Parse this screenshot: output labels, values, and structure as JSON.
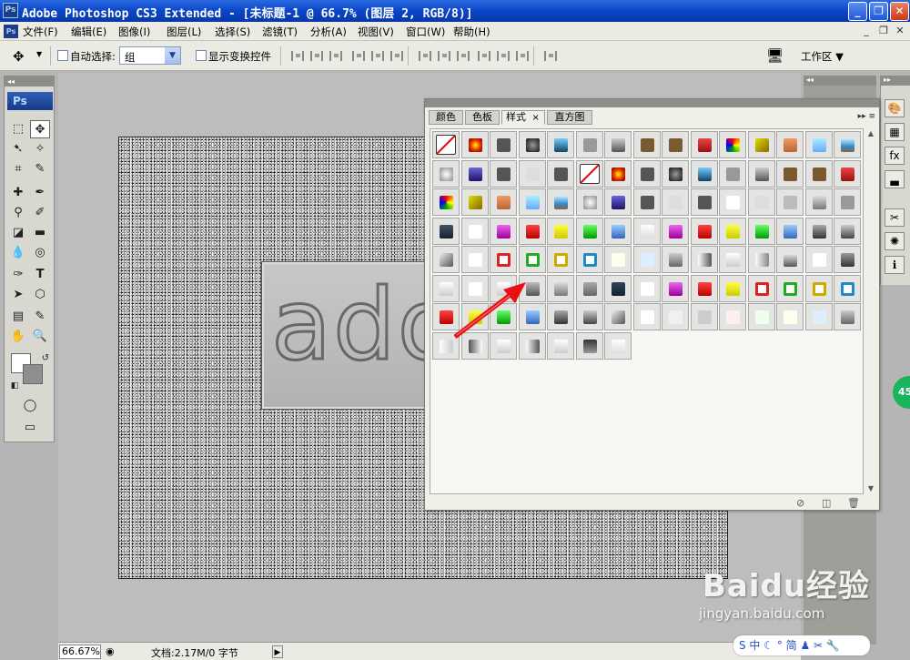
{
  "window": {
    "title": "Adobe Photoshop CS3 Extended - [未标题-1 @ 66.7% (图层 2, RGB/8)]",
    "app_icon": "Ps",
    "controls": [
      "minimize-icon",
      "restore-icon",
      "close-icon"
    ]
  },
  "menubar": {
    "items": [
      "文件(F)",
      "编辑(E)",
      "图像(I)",
      "图层(L)",
      "选择(S)",
      "滤镜(T)",
      "分析(A)",
      "视图(V)",
      "窗口(W)",
      "帮助(H)"
    ]
  },
  "options_bar": {
    "auto_select_label": "自动选择:",
    "auto_select_value": "组",
    "auto_select_checked": false,
    "show_transform_label": "显示变换控件",
    "show_transform_checked": false,
    "workspace_label": "工作区 ▼"
  },
  "toolbox": {
    "logo": "Ps",
    "foreground_color": "#ffffff",
    "background_color": "#8e8e8e"
  },
  "document": {
    "layer_text": "adob"
  },
  "styles_panel": {
    "tabs": [
      "颜色",
      "色板",
      "样式",
      "直方图"
    ],
    "active_tab": "样式",
    "tab_close": "×",
    "bottom_icons": [
      "clear-style-icon",
      "new-style-icon",
      "trash-icon"
    ]
  },
  "statusbar": {
    "zoom": "66.67%",
    "doc_info": "文档:2.17M/0 字节"
  },
  "overlay": {
    "badge": "45",
    "watermark_main": "Baidu经验",
    "watermark_sub": "jingyan.baidu.com",
    "tray_text": "S 中 ☾ ° 简 ♟ ✂ 🔧"
  }
}
